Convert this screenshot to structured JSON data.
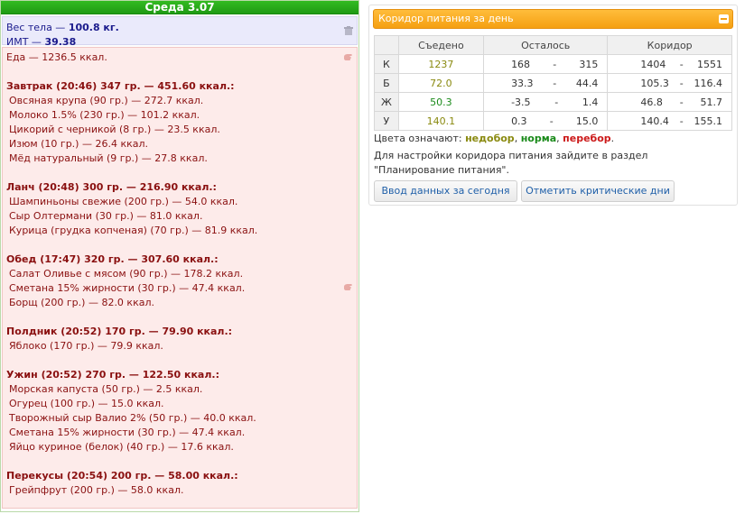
{
  "day": {
    "title": "Среда 3.07"
  },
  "stats": {
    "weight_label": "Вес тела — ",
    "weight_value": "100.8 кг.",
    "bmi_label": "ИМТ — ",
    "bmi_value": "39.38"
  },
  "food": {
    "total": "Еда — 1236.5 ккал.",
    "meals": [
      {
        "title": "Завтрак (20:46) 347 гр. — 451.60 ккал.:",
        "items": [
          "Овсяная крупа (90 гр.) — 272.7 ккал.",
          "Молоко 1.5% (230 гр.) — 101.2 ккал.",
          "Цикорий с черникой (8 гр.) — 23.5 ккал.",
          "Изюм (10 гр.) — 26.4 ккал.",
          "Мёд натуральный (9 гр.) — 27.8 ккал."
        ]
      },
      {
        "title": "Ланч (20:48) 300 гр. — 216.90 ккал.:",
        "items": [
          "Шампиньоны свежие (200 гр.) — 54.0 ккал.",
          "Сыр Олтермани (30 гр.) — 81.0 ккал.",
          "Курица (грудка копченая) (70 гр.) — 81.9 ккал."
        ]
      },
      {
        "title": "Обед (17:47) 320 гр. — 307.60 ккал.:",
        "items": [
          "Салат Оливье с мясом (90 гр.) — 178.2 ккал.",
          "Сметана 15% жирности (30 гр.) — 47.4 ккал.",
          "Борщ (200 гр.) — 82.0 ккал."
        ]
      },
      {
        "title": "Полдник (20:52) 170 гр. — 79.90 ккал.:",
        "items": [
          "Яблоко (170 гр.) — 79.9 ккал."
        ]
      },
      {
        "title": "Ужин (20:52) 270 гр. — 122.50 ккал.:",
        "items": [
          "Морская капуста (50 гр.) — 2.5 ккал.",
          "Огурец (100 гр.) — 15.0 ккал.",
          "Творожный сыр Валио 2% (50 гр.) — 40.0 ккал.",
          "Сметана 15% жирности (30 гр.) — 47.4 ккал.",
          "Яйцо куриное (белок) (40 гр.) — 17.6 ккал."
        ]
      },
      {
        "title": "Перекусы (20:54) 200 гр. — 58.00 ккал.:",
        "items": [
          "Грейпфрут (200 гр.) — 58.0 ккал."
        ]
      }
    ]
  },
  "corridor": {
    "title": "Коридор питания за день",
    "headers": {
      "eaten": "Съедено",
      "left": "Осталось",
      "corridor": "Коридор"
    },
    "rows": [
      {
        "label": "К",
        "eaten": "1237",
        "left_min": "168",
        "left_max": "315",
        "cor_min": "1404",
        "cor_max": "1551",
        "status": "under"
      },
      {
        "label": "Б",
        "eaten": "72.0",
        "left_min": "33.3",
        "left_max": "44.4",
        "cor_min": "105.3",
        "cor_max": "116.4",
        "status": "under"
      },
      {
        "label": "Ж",
        "eaten": "50.3",
        "left_min": "-3.5",
        "left_max": "1.4",
        "cor_min": "46.8",
        "cor_max": "51.7",
        "status": "norm"
      },
      {
        "label": "У",
        "eaten": "140.1",
        "left_min": "0.3",
        "left_max": "15.0",
        "cor_min": "140.4",
        "cor_max": "155.1",
        "status": "under"
      }
    ],
    "dash": "-",
    "legend": {
      "prefix": "Цвета означают: ",
      "under": "недобор",
      "sep1": ", ",
      "norm": "норма",
      "sep2": ", ",
      "over": "перебор",
      "suffix": "."
    },
    "hint": "Для настройки коридора питания зайдите в раздел \"Планирование питания\".",
    "buttons": {
      "today": "Ввод данных за сегодня",
      "critical": "Отметить критические дни"
    }
  },
  "colors": {
    "under": "#8a8a10",
    "norm": "#1a8a1a",
    "over": "#cc1a1a",
    "accent": "#f5a012",
    "header_green": "#1f9a14"
  }
}
